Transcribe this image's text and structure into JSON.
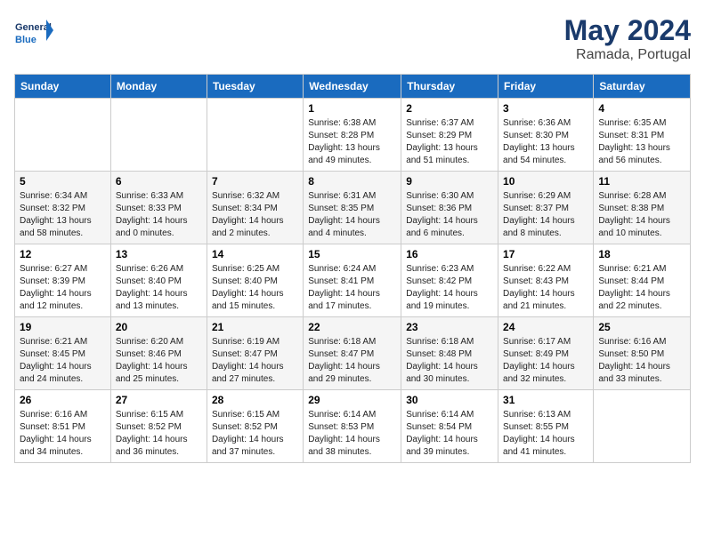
{
  "header": {
    "logo_line1": "General",
    "logo_line2": "Blue",
    "month": "May 2024",
    "location": "Ramada, Portugal"
  },
  "days_of_week": [
    "Sunday",
    "Monday",
    "Tuesday",
    "Wednesday",
    "Thursday",
    "Friday",
    "Saturday"
  ],
  "weeks": [
    [
      {
        "day": "",
        "sunrise": "",
        "sunset": "",
        "daylight": ""
      },
      {
        "day": "",
        "sunrise": "",
        "sunset": "",
        "daylight": ""
      },
      {
        "day": "",
        "sunrise": "",
        "sunset": "",
        "daylight": ""
      },
      {
        "day": "1",
        "sunrise": "Sunrise: 6:38 AM",
        "sunset": "Sunset: 8:28 PM",
        "daylight": "Daylight: 13 hours and 49 minutes."
      },
      {
        "day": "2",
        "sunrise": "Sunrise: 6:37 AM",
        "sunset": "Sunset: 8:29 PM",
        "daylight": "Daylight: 13 hours and 51 minutes."
      },
      {
        "day": "3",
        "sunrise": "Sunrise: 6:36 AM",
        "sunset": "Sunset: 8:30 PM",
        "daylight": "Daylight: 13 hours and 54 minutes."
      },
      {
        "day": "4",
        "sunrise": "Sunrise: 6:35 AM",
        "sunset": "Sunset: 8:31 PM",
        "daylight": "Daylight: 13 hours and 56 minutes."
      }
    ],
    [
      {
        "day": "5",
        "sunrise": "Sunrise: 6:34 AM",
        "sunset": "Sunset: 8:32 PM",
        "daylight": "Daylight: 13 hours and 58 minutes."
      },
      {
        "day": "6",
        "sunrise": "Sunrise: 6:33 AM",
        "sunset": "Sunset: 8:33 PM",
        "daylight": "Daylight: 14 hours and 0 minutes."
      },
      {
        "day": "7",
        "sunrise": "Sunrise: 6:32 AM",
        "sunset": "Sunset: 8:34 PM",
        "daylight": "Daylight: 14 hours and 2 minutes."
      },
      {
        "day": "8",
        "sunrise": "Sunrise: 6:31 AM",
        "sunset": "Sunset: 8:35 PM",
        "daylight": "Daylight: 14 hours and 4 minutes."
      },
      {
        "day": "9",
        "sunrise": "Sunrise: 6:30 AM",
        "sunset": "Sunset: 8:36 PM",
        "daylight": "Daylight: 14 hours and 6 minutes."
      },
      {
        "day": "10",
        "sunrise": "Sunrise: 6:29 AM",
        "sunset": "Sunset: 8:37 PM",
        "daylight": "Daylight: 14 hours and 8 minutes."
      },
      {
        "day": "11",
        "sunrise": "Sunrise: 6:28 AM",
        "sunset": "Sunset: 8:38 PM",
        "daylight": "Daylight: 14 hours and 10 minutes."
      }
    ],
    [
      {
        "day": "12",
        "sunrise": "Sunrise: 6:27 AM",
        "sunset": "Sunset: 8:39 PM",
        "daylight": "Daylight: 14 hours and 12 minutes."
      },
      {
        "day": "13",
        "sunrise": "Sunrise: 6:26 AM",
        "sunset": "Sunset: 8:40 PM",
        "daylight": "Daylight: 14 hours and 13 minutes."
      },
      {
        "day": "14",
        "sunrise": "Sunrise: 6:25 AM",
        "sunset": "Sunset: 8:40 PM",
        "daylight": "Daylight: 14 hours and 15 minutes."
      },
      {
        "day": "15",
        "sunrise": "Sunrise: 6:24 AM",
        "sunset": "Sunset: 8:41 PM",
        "daylight": "Daylight: 14 hours and 17 minutes."
      },
      {
        "day": "16",
        "sunrise": "Sunrise: 6:23 AM",
        "sunset": "Sunset: 8:42 PM",
        "daylight": "Daylight: 14 hours and 19 minutes."
      },
      {
        "day": "17",
        "sunrise": "Sunrise: 6:22 AM",
        "sunset": "Sunset: 8:43 PM",
        "daylight": "Daylight: 14 hours and 21 minutes."
      },
      {
        "day": "18",
        "sunrise": "Sunrise: 6:21 AM",
        "sunset": "Sunset: 8:44 PM",
        "daylight": "Daylight: 14 hours and 22 minutes."
      }
    ],
    [
      {
        "day": "19",
        "sunrise": "Sunrise: 6:21 AM",
        "sunset": "Sunset: 8:45 PM",
        "daylight": "Daylight: 14 hours and 24 minutes."
      },
      {
        "day": "20",
        "sunrise": "Sunrise: 6:20 AM",
        "sunset": "Sunset: 8:46 PM",
        "daylight": "Daylight: 14 hours and 25 minutes."
      },
      {
        "day": "21",
        "sunrise": "Sunrise: 6:19 AM",
        "sunset": "Sunset: 8:47 PM",
        "daylight": "Daylight: 14 hours and 27 minutes."
      },
      {
        "day": "22",
        "sunrise": "Sunrise: 6:18 AM",
        "sunset": "Sunset: 8:47 PM",
        "daylight": "Daylight: 14 hours and 29 minutes."
      },
      {
        "day": "23",
        "sunrise": "Sunrise: 6:18 AM",
        "sunset": "Sunset: 8:48 PM",
        "daylight": "Daylight: 14 hours and 30 minutes."
      },
      {
        "day": "24",
        "sunrise": "Sunrise: 6:17 AM",
        "sunset": "Sunset: 8:49 PM",
        "daylight": "Daylight: 14 hours and 32 minutes."
      },
      {
        "day": "25",
        "sunrise": "Sunrise: 6:16 AM",
        "sunset": "Sunset: 8:50 PM",
        "daylight": "Daylight: 14 hours and 33 minutes."
      }
    ],
    [
      {
        "day": "26",
        "sunrise": "Sunrise: 6:16 AM",
        "sunset": "Sunset: 8:51 PM",
        "daylight": "Daylight: 14 hours and 34 minutes."
      },
      {
        "day": "27",
        "sunrise": "Sunrise: 6:15 AM",
        "sunset": "Sunset: 8:52 PM",
        "daylight": "Daylight: 14 hours and 36 minutes."
      },
      {
        "day": "28",
        "sunrise": "Sunrise: 6:15 AM",
        "sunset": "Sunset: 8:52 PM",
        "daylight": "Daylight: 14 hours and 37 minutes."
      },
      {
        "day": "29",
        "sunrise": "Sunrise: 6:14 AM",
        "sunset": "Sunset: 8:53 PM",
        "daylight": "Daylight: 14 hours and 38 minutes."
      },
      {
        "day": "30",
        "sunrise": "Sunrise: 6:14 AM",
        "sunset": "Sunset: 8:54 PM",
        "daylight": "Daylight: 14 hours and 39 minutes."
      },
      {
        "day": "31",
        "sunrise": "Sunrise: 6:13 AM",
        "sunset": "Sunset: 8:55 PM",
        "daylight": "Daylight: 14 hours and 41 minutes."
      },
      {
        "day": "",
        "sunrise": "",
        "sunset": "",
        "daylight": ""
      }
    ]
  ]
}
